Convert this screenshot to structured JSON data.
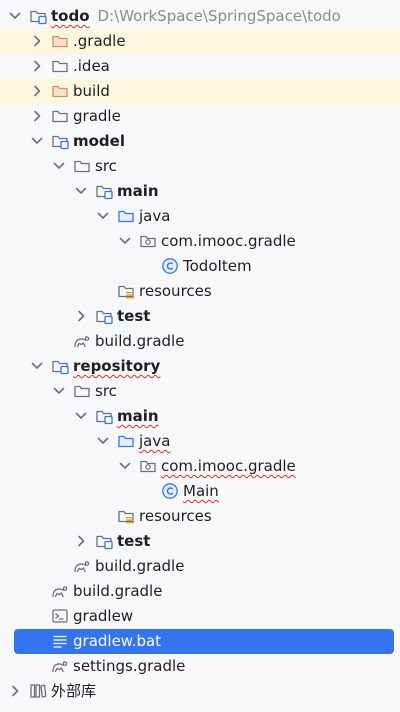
{
  "tree": [
    {
      "depth": 0,
      "expand": "open",
      "icon": "module-icon",
      "label": "todo",
      "bold": true,
      "squiggle": true,
      "path": "D:\\WorkSpace\\SpringSpace\\todo"
    },
    {
      "depth": 1,
      "expand": "closed",
      "icon": "folder-orange-icon",
      "label": ".gradle",
      "highlight": true
    },
    {
      "depth": 1,
      "expand": "closed",
      "icon": "folder-icon",
      "label": ".idea"
    },
    {
      "depth": 1,
      "expand": "closed",
      "icon": "folder-orange-icon",
      "label": "build",
      "highlight": true
    },
    {
      "depth": 1,
      "expand": "closed",
      "icon": "folder-icon",
      "label": "gradle"
    },
    {
      "depth": 1,
      "expand": "open",
      "icon": "module-icon",
      "label": "model",
      "bold": true
    },
    {
      "depth": 2,
      "expand": "open",
      "icon": "folder-icon",
      "label": "src"
    },
    {
      "depth": 3,
      "expand": "open",
      "icon": "module-folder-icon",
      "label": "main",
      "bold": true
    },
    {
      "depth": 4,
      "expand": "open",
      "icon": "source-folder-icon",
      "label": "java"
    },
    {
      "depth": 5,
      "expand": "open",
      "icon": "package-icon",
      "label": "com.imooc.gradle"
    },
    {
      "depth": 6,
      "expand": "none",
      "icon": "class-icon",
      "label": "TodoItem"
    },
    {
      "depth": 4,
      "expand": "none",
      "icon": "resources-folder-icon",
      "label": "resources"
    },
    {
      "depth": 3,
      "expand": "closed",
      "icon": "module-folder-icon",
      "label": "test",
      "bold": true
    },
    {
      "depth": 2,
      "expand": "none",
      "icon": "gradle-icon",
      "label": "build.gradle"
    },
    {
      "depth": 1,
      "expand": "open",
      "icon": "module-icon",
      "label": "repository",
      "bold": true,
      "squiggle": true
    },
    {
      "depth": 2,
      "expand": "open",
      "icon": "folder-icon",
      "label": "src"
    },
    {
      "depth": 3,
      "expand": "open",
      "icon": "module-folder-icon",
      "label": "main",
      "bold": true,
      "squiggle": true
    },
    {
      "depth": 4,
      "expand": "open",
      "icon": "source-folder-icon",
      "label": "java",
      "squiggle": true
    },
    {
      "depth": 5,
      "expand": "open",
      "icon": "package-icon",
      "label": "com.imooc.gradle",
      "squiggle": true
    },
    {
      "depth": 6,
      "expand": "none",
      "icon": "class-icon",
      "label": "Main",
      "squiggle": true
    },
    {
      "depth": 4,
      "expand": "none",
      "icon": "resources-folder-icon",
      "label": "resources"
    },
    {
      "depth": 3,
      "expand": "closed",
      "icon": "module-folder-icon",
      "label": "test",
      "bold": true
    },
    {
      "depth": 2,
      "expand": "none",
      "icon": "gradle-icon",
      "label": "build.gradle"
    },
    {
      "depth": 1,
      "expand": "none",
      "icon": "gradle-icon",
      "label": "build.gradle"
    },
    {
      "depth": 1,
      "expand": "none",
      "icon": "terminal-file-icon",
      "label": "gradlew"
    },
    {
      "depth": 1,
      "expand": "none",
      "icon": "text-file-icon",
      "label": "gradlew.bat",
      "selected": true
    },
    {
      "depth": 1,
      "expand": "none",
      "icon": "gradle-icon",
      "label": "settings.gradle"
    },
    {
      "depth": 0,
      "expand": "closed",
      "icon": "library-icon",
      "label": "外部库"
    }
  ],
  "colors": {
    "selection": "#3574f0",
    "highlight": "#fdf8dd",
    "folder": "#6c707e",
    "folder_excluded": "#e08855",
    "source_folder": "#3574f0",
    "class": "#3574f0",
    "resources_badge": "#d9a343",
    "squiggle": "#e0301e"
  }
}
